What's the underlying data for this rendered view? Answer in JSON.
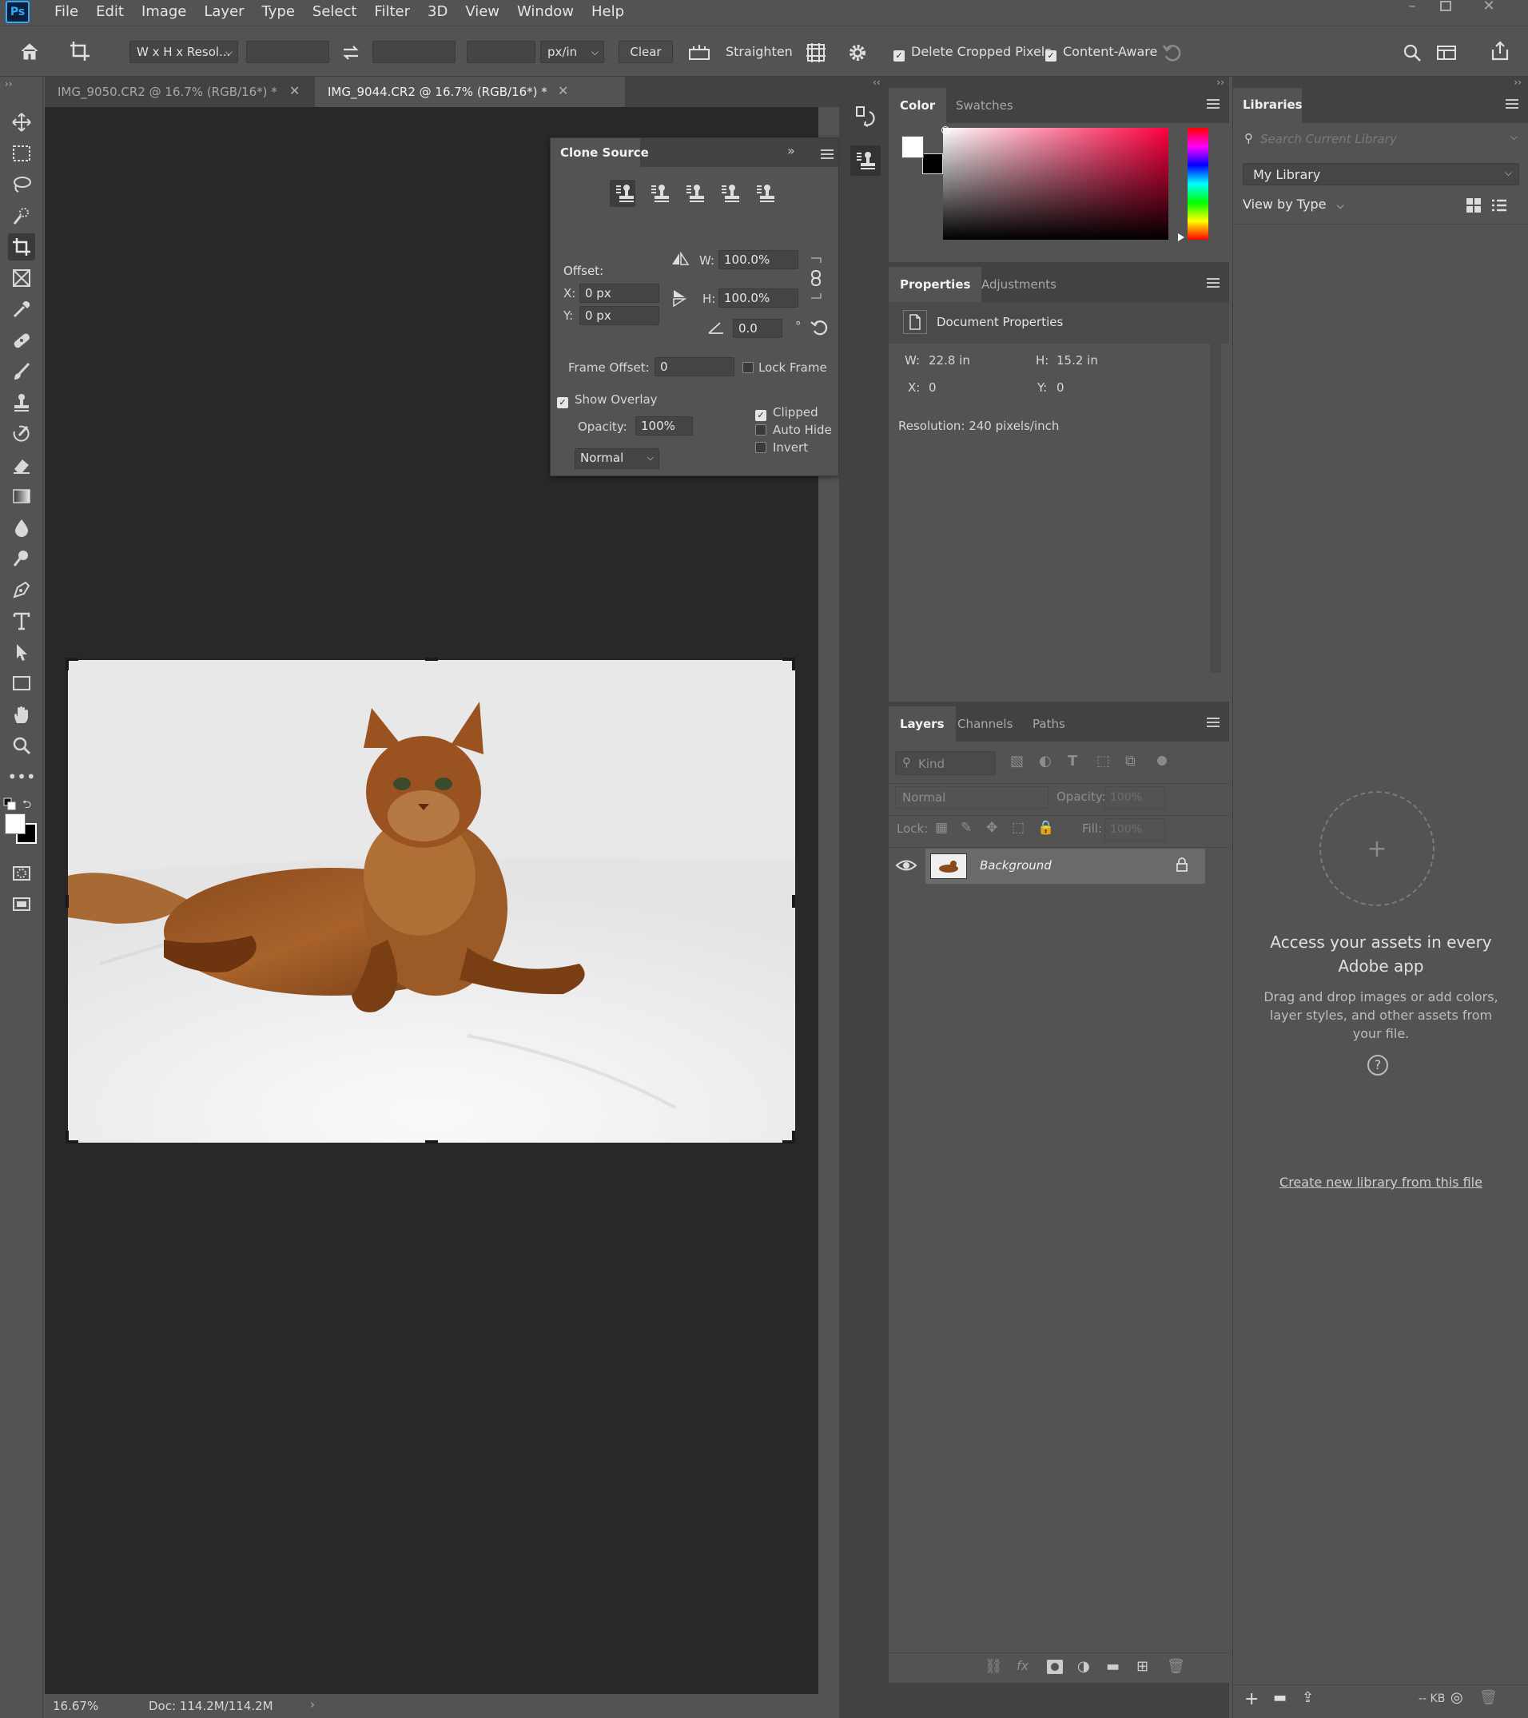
{
  "app": {
    "logo": "Ps"
  },
  "menu": [
    "File",
    "Edit",
    "Image",
    "Layer",
    "Type",
    "Select",
    "Filter",
    "3D",
    "View",
    "Window",
    "Help"
  ],
  "options": {
    "ratio_select": "W x H x Resol...",
    "unit_select": "px/in",
    "clear_label": "Clear",
    "straighten_label": "Straighten",
    "delete_cropped_label": "Delete Cropped Pixels",
    "delete_cropped_checked": true,
    "content_aware_label": "Content-Aware",
    "content_aware_checked": true
  },
  "tabs": [
    {
      "label": "IMG_9050.CR2 @ 16.7% (RGB/16*) *",
      "active": false
    },
    {
      "label": "IMG_9044.CR2 @ 16.7% (RGB/16*) *",
      "active": true
    }
  ],
  "status": {
    "zoom": "16.67%",
    "doc": "Doc: 114.2M/114.2M"
  },
  "clone_source": {
    "title": "Clone Source",
    "offset_label": "Offset:",
    "x_label": "X:",
    "x_value": "0 px",
    "y_label": "Y:",
    "y_value": "0 px",
    "w_label": "W:",
    "w_value": "100.0%",
    "h_label": "H:",
    "h_value": "100.0%",
    "angle_value": "0.0",
    "degree": "°",
    "frame_offset_label": "Frame Offset:",
    "frame_offset_value": "0",
    "lock_frame_label": "Lock Frame",
    "show_overlay_label": "Show Overlay",
    "opacity_label": "Opacity:",
    "opacity_value": "100%",
    "clipped_label": "Clipped",
    "auto_hide_label": "Auto Hide",
    "invert_label": "Invert",
    "blend_mode": "Normal"
  },
  "color_panel": {
    "tab_color": "Color",
    "tab_swatches": "Swatches",
    "hue": "#ff0040",
    "fg": "#ffffff",
    "bg": "#000000"
  },
  "properties": {
    "tab_properties": "Properties",
    "tab_adjustments": "Adjustments",
    "doc_label": "Document Properties",
    "w_label": "W:",
    "w_value": "22.8 in",
    "h_label": "H:",
    "h_value": "15.2 in",
    "x_label": "X:",
    "x_value": "0",
    "y_label": "Y:",
    "y_value": "0",
    "resolution": "Resolution: 240 pixels/inch"
  },
  "layers": {
    "tab_layers": "Layers",
    "tab_channels": "Channels",
    "tab_paths": "Paths",
    "filter_kind": "Kind",
    "blend_mode": "Normal",
    "opacity_label": "Opacity:",
    "opacity_value": "100%",
    "lock_label": "Lock:",
    "fill_label": "Fill:",
    "fill_value": "100%",
    "layer_name": "Background"
  },
  "libraries": {
    "title": "Libraries",
    "search_placeholder": "Search Current Library",
    "library_name": "My Library",
    "view_by": "View by Type",
    "empty_title": "Access your assets in every Adobe app",
    "empty_desc": "Drag and drop images or add colors, layer styles, and other assets from your file.",
    "help": "?",
    "create_link": "Create new library from this file",
    "size": "-- KB"
  }
}
